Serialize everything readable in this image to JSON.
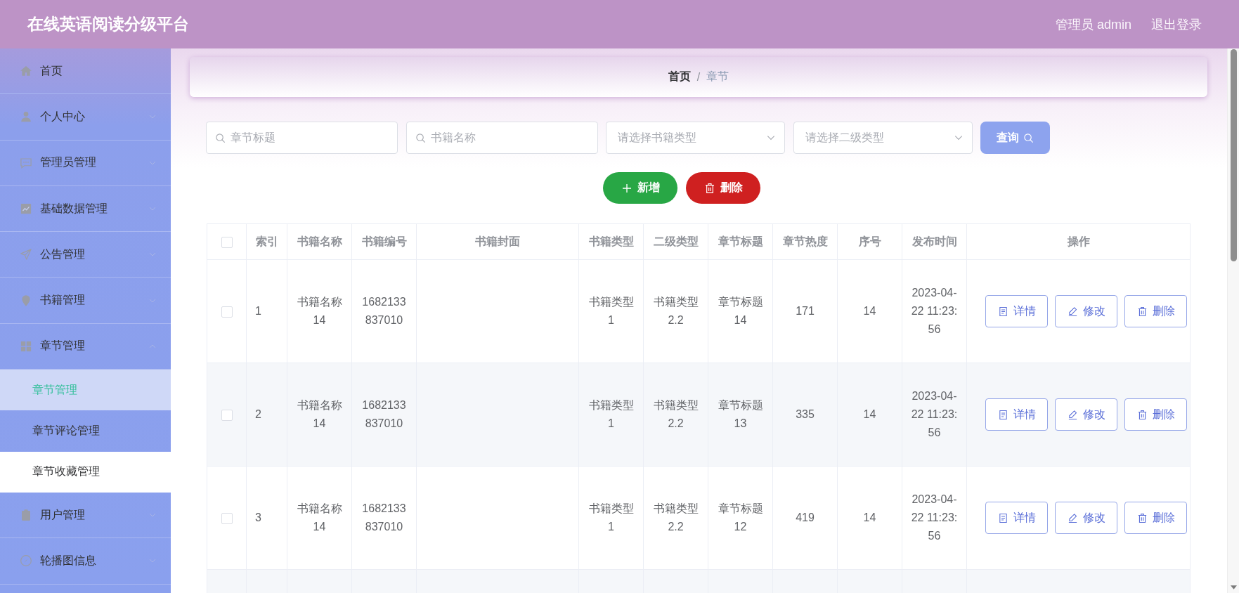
{
  "header": {
    "title": "在线英语阅读分级平台",
    "user": "管理员 admin",
    "logout": "退出登录"
  },
  "sidebar": {
    "items": [
      {
        "kind": "link",
        "label": "首页",
        "selected": false
      },
      {
        "kind": "submenu",
        "label": "个人中心",
        "selected": false,
        "expanded": false
      },
      {
        "kind": "submenu",
        "label": "管理员管理",
        "selected": false,
        "expanded": false
      },
      {
        "kind": "submenu",
        "label": "基础数据管理",
        "selected": false,
        "expanded": false
      },
      {
        "kind": "submenu",
        "label": "公告管理",
        "selected": false,
        "expanded": false
      },
      {
        "kind": "submenu",
        "label": "书籍管理",
        "selected": false,
        "expanded": false
      },
      {
        "kind": "submenu",
        "label": "章节管理",
        "selected": false,
        "expanded": true,
        "children": [
          {
            "label": "章节管理",
            "selected": true,
            "hovered": false
          },
          {
            "label": "章节评论管理",
            "selected": false,
            "hovered": false
          },
          {
            "label": "章节收藏管理",
            "selected": false,
            "hovered": true
          }
        ]
      },
      {
        "kind": "submenu",
        "label": "用户管理",
        "selected": false,
        "expanded": false
      },
      {
        "kind": "submenu",
        "label": "轮播图信息",
        "selected": false,
        "expanded": false
      }
    ]
  },
  "breadcrumb": {
    "separator": "/",
    "items": [
      {
        "label": "首页",
        "current": false
      },
      {
        "label": "章节",
        "current": true
      }
    ]
  },
  "filters": {
    "fields": [
      {
        "kind": "text",
        "placeholder": "章节标题"
      },
      {
        "kind": "text",
        "placeholder": "书籍名称"
      },
      {
        "kind": "select",
        "placeholder": "请选择书籍类型"
      },
      {
        "kind": "select",
        "placeholder": "请选择二级类型"
      }
    ],
    "search_button": "查询"
  },
  "actions": [
    {
      "kind": "add",
      "label": "新增"
    },
    {
      "kind": "delete",
      "label": "删除"
    }
  ],
  "table": {
    "select_all": {
      "checked": false
    },
    "columns": [
      {
        "kind": "index",
        "label": "索引"
      },
      {
        "kind": "text",
        "label": "书籍名称"
      },
      {
        "kind": "text",
        "label": "书籍编号"
      },
      {
        "kind": "image",
        "label": "书籍封面"
      },
      {
        "kind": "text",
        "label": "书籍类型"
      },
      {
        "kind": "text",
        "label": "二级类型"
      },
      {
        "kind": "text",
        "label": "章节标题"
      },
      {
        "kind": "text",
        "label": "章节热度"
      },
      {
        "kind": "text",
        "label": "序号"
      },
      {
        "kind": "text",
        "label": "发布时间"
      },
      {
        "kind": "actions",
        "label": "操作"
      }
    ],
    "rows": [
      {
        "checked": false,
        "cells": [
          "1",
          "书籍名称14",
          "1682133837010",
          "",
          "书籍类型1",
          "书籍类型2.2",
          "章节标题14",
          "171",
          "14",
          "2023-04-22 11:23:56"
        ],
        "actions": [
          {
            "kind": "detail",
            "label": "详情"
          },
          {
            "kind": "edit",
            "label": "修改"
          },
          {
            "kind": "delete",
            "label": "删除"
          }
        ]
      },
      {
        "checked": false,
        "cells": [
          "2",
          "书籍名称14",
          "1682133837010",
          "",
          "书籍类型1",
          "书籍类型2.2",
          "章节标题13",
          "335",
          "14",
          "2023-04-22 11:23:56"
        ],
        "actions": [
          {
            "kind": "detail",
            "label": "详情"
          },
          {
            "kind": "edit",
            "label": "修改"
          },
          {
            "kind": "delete",
            "label": "删除"
          }
        ]
      },
      {
        "checked": false,
        "cells": [
          "3",
          "书籍名称14",
          "1682133837010",
          "",
          "书籍类型1",
          "书籍类型2.2",
          "章节标题12",
          "419",
          "14",
          "2023-04-22 11:23:56"
        ],
        "actions": [
          {
            "kind": "detail",
            "label": "详情"
          },
          {
            "kind": "edit",
            "label": "修改"
          },
          {
            "kind": "delete",
            "label": "删除"
          }
        ]
      }
    ]
  }
}
